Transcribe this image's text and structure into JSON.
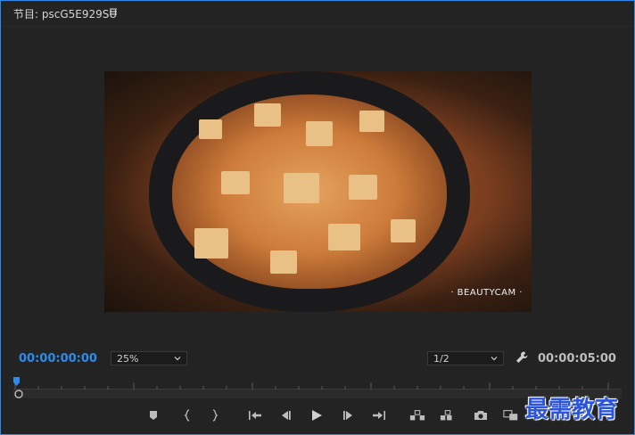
{
  "panel": {
    "title": "节目: pscG5E929SU",
    "video_watermark": "· BEAUTYCAM ·"
  },
  "transport": {
    "timecode_current": "00:00:00:00",
    "timecode_duration": "00:00:05:00",
    "zoom_select_value": "25%",
    "resolution_select_value": "1/2"
  },
  "overlay": {
    "site_logo_text": "最需教育"
  },
  "colors": {
    "accent": "#2d8ceb",
    "panel_bg": "#232323",
    "logo_blue": "#2c55d8"
  },
  "icons": [
    "panel-menu-icon",
    "zoom-chevron-down-icon",
    "resolution-chevron-down-icon",
    "settings-wrench-icon",
    "add-marker-icon",
    "mark-in-icon",
    "mark-out-icon",
    "go-to-in-icon",
    "step-back-icon",
    "play-icon",
    "step-forward-icon",
    "go-to-out-icon",
    "lift-icon",
    "extract-icon",
    "export-frame-camera-icon",
    "comparison-view-icon",
    "add-button-icon"
  ]
}
